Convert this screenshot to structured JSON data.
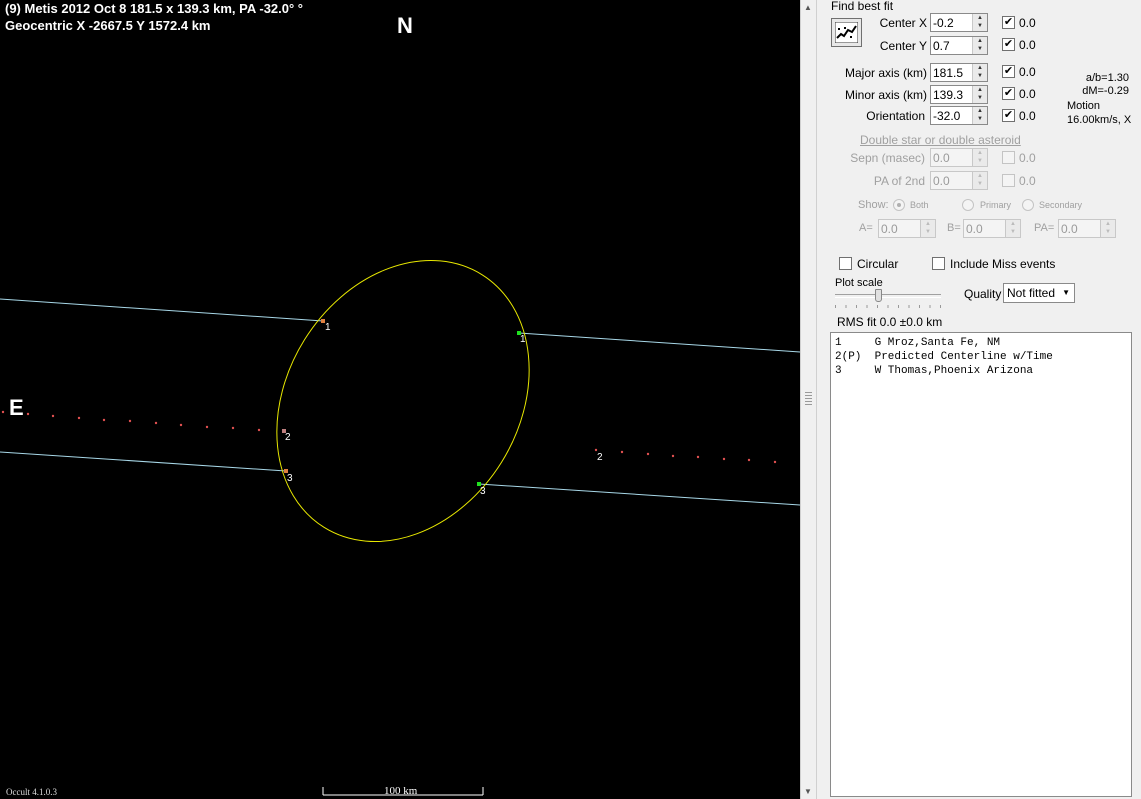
{
  "plot": {
    "title_line1": "(9) Metis  2012 Oct 8   181.5 x 139.3 km, PA -32.0° °",
    "title_line2": "Geocentric  X  -2667.5  Y 1572.4 km",
    "north": "N",
    "east": "E",
    "version": "Occult 4.1.0.3",
    "scale_label": "100 km",
    "labels": {
      "c1d": "1",
      "c1r": "1",
      "c2d": "2",
      "c2r": "2",
      "c3d": "3",
      "c3r": "3"
    },
    "colors": {
      "background": "#000000",
      "ellipse": "#e8e800",
      "chord": "#a8d8e8",
      "dots": "#e05050",
      "reappear": "#20e020"
    }
  },
  "panel": {
    "find_best_fit": "Find best fit",
    "fit_icon": "chart-fit-icon",
    "center_x": {
      "label": "Center X",
      "value": "-0.2",
      "checked": true,
      "delta": "0.0"
    },
    "center_y": {
      "label": "Center Y",
      "value": "0.7",
      "checked": true,
      "delta": "0.0"
    },
    "major_axis": {
      "label": "Major axis (km)",
      "value": "181.5",
      "checked": true,
      "delta": "0.0"
    },
    "minor_axis": {
      "label": "Minor axis (km)",
      "value": "139.3",
      "checked": true,
      "delta": "0.0"
    },
    "orientation": {
      "label": "Orientation",
      "value": "-32.0",
      "checked": true,
      "delta": "0.0"
    },
    "ab_ratio": "a/b=1.30",
    "dm": "dM=-0.29",
    "motion_label": "Motion",
    "motion_value": "16.00km/s, X",
    "double_star_link": "Double star  or  double asteroid",
    "sepn": {
      "label": "Sepn (masec)",
      "value": "0.0",
      "delta": "0.0"
    },
    "pa2": {
      "label": "PA of 2nd",
      "value": "0.0",
      "delta": "0.0"
    },
    "show_label": "Show:",
    "show_options": [
      "Both",
      "Primary",
      "Secondary"
    ],
    "a_label": "A=",
    "a_value": "0.0",
    "b_label": "B=",
    "b_value": "0.0",
    "pa_label": "PA=",
    "pa_value": "0.0",
    "circular_label": "Circular",
    "include_miss_label": "Include Miss events",
    "plot_scale_label": "Plot scale",
    "plot_scale_level": 0.4,
    "quality_label": "Quality",
    "quality_value": "Not fitted",
    "rms_fit": "RMS fit  0.0 ±0.0 km",
    "observers": [
      "1     G Mroz,Santa Fe, NM",
      "2(P)  Predicted Centerline w/Time",
      "3     W Thomas,Phoenix Arizona"
    ]
  }
}
